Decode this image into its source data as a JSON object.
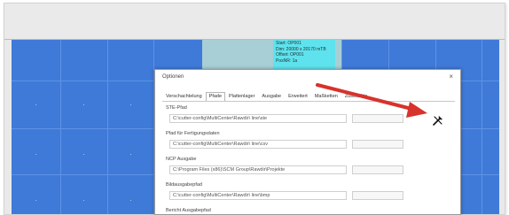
{
  "info_box": {
    "lines": [
      "Start: OP001",
      "Dim: 20000 x 20170 mTB",
      "Offset: OP001",
      "PosNR: 1a"
    ]
  },
  "dialog": {
    "title": "Optionen",
    "close_glyph": "×",
    "tabs": [
      "Verschachtelung",
      "Pfade",
      "Plattenlager",
      "Ausgabe",
      "Erweitert",
      "Maßketten",
      "Zuschnitte"
    ],
    "active_tab": "Pfade",
    "fields": [
      {
        "label": "STE-Pfad",
        "value": "C:\\cutter-config\\MultiCenter\\Rawdir\\ line\\ste"
      },
      {
        "label": "Pfad für Fertigungsdaten",
        "value": "C:\\cutter-config\\MultiCenter\\Rawdir\\ line\\csv"
      },
      {
        "label": "NCP Ausgabe",
        "value": "C:\\Program Files (x86)\\SCM Group\\Rawdir\\Projekte"
      },
      {
        "label": "Bildausgabepfad",
        "value": "C:\\cutter-config\\MultiCenter\\Rawdir\\ line\\bmp"
      },
      {
        "label": "Bericht Ausgabepfad",
        "value": ""
      }
    ]
  },
  "icons": {
    "tool": "wrench-screwdriver-icon",
    "close": "close-icon",
    "arrow": "red-arrow-annotation"
  },
  "colors": {
    "plate_blue": "#3f7ad8",
    "info_cyan": "#5ee3ee",
    "arrow_red": "#d8322c"
  }
}
